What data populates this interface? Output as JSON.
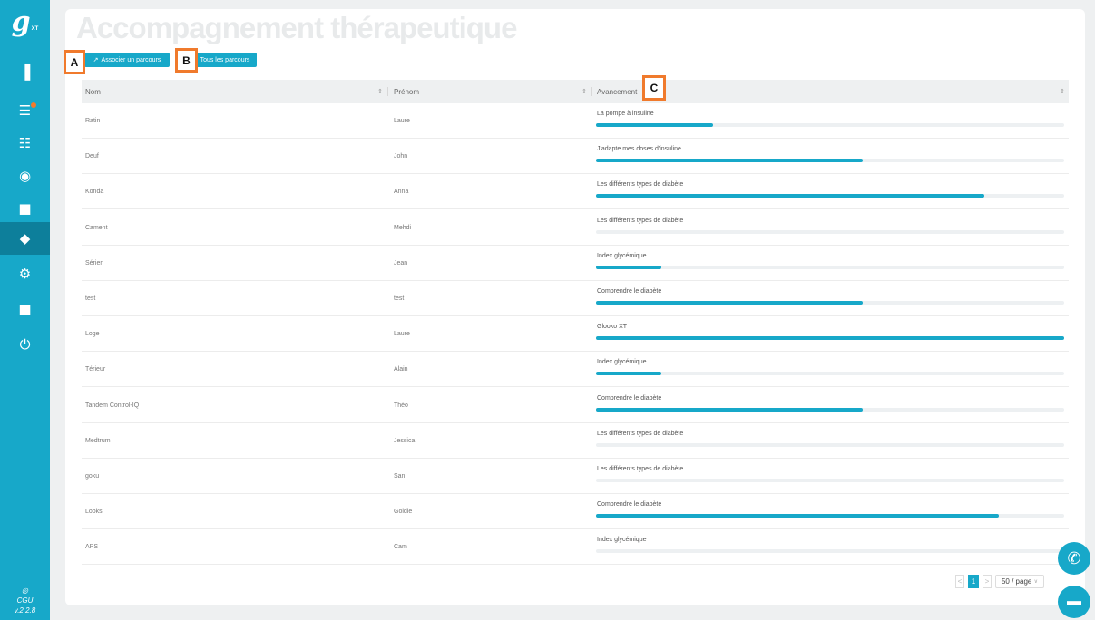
{
  "sidebar": {
    "logo_letter": "g",
    "logo_suffix": "XT",
    "items": [
      {
        "icon": "chart-bar-icon",
        "glyph": "▐"
      },
      {
        "icon": "list-icon",
        "glyph": "☰"
      },
      {
        "icon": "document-check-icon",
        "glyph": "☷"
      },
      {
        "icon": "users-icon",
        "glyph": "◉"
      },
      {
        "icon": "chat-icon",
        "glyph": "■"
      },
      {
        "icon": "graduation-cap-icon",
        "glyph": "◆"
      },
      {
        "icon": "gear-icon",
        "glyph": "⚙"
      },
      {
        "icon": "book-icon",
        "glyph": "■"
      },
      {
        "icon": "power-icon",
        "glyph": "⏻"
      }
    ],
    "globe_glyph": "◎",
    "cgu_label": "CGU",
    "version": "v.2.2.8"
  },
  "page": {
    "title": "Accompagnement thérapeutique"
  },
  "buttons": {
    "associer_label": "Associer un parcours",
    "associer_icon": "↗",
    "tous_label": "Tous les parcours"
  },
  "annotations": {
    "a": "A",
    "b": "B",
    "c": "C"
  },
  "table": {
    "headers": {
      "nom": "Nom",
      "prenom": "Prénom",
      "avancement": "Avancement"
    },
    "sort_glyph": "⇕",
    "rows": [
      {
        "nom": "Ratin",
        "prenom": "Laure",
        "parcours": "La pompe à insuline",
        "progress": 0.25
      },
      {
        "nom": "Deuf",
        "prenom": "John",
        "parcours": "J'adapte mes doses d'insuline",
        "progress": 0.57
      },
      {
        "nom": "Konda",
        "prenom": "Anna",
        "parcours": "Les différents types de diabète",
        "progress": 0.83
      },
      {
        "nom": "Cament",
        "prenom": "Mehdi",
        "parcours": "Les différents types de diabète",
        "progress": 0.0
      },
      {
        "nom": "Sérien",
        "prenom": "Jean",
        "parcours": "Index glycémique",
        "progress": 0.14
      },
      {
        "nom": "test",
        "prenom": "test",
        "parcours": "Comprendre le diabète",
        "progress": 0.57
      },
      {
        "nom": "Loge",
        "prenom": "Laure",
        "parcours": "Glooko XT",
        "progress": 1.0
      },
      {
        "nom": "Térieur",
        "prenom": "Alain",
        "parcours": "Index glycémique",
        "progress": 0.14
      },
      {
        "nom": "Tandem Control-IQ",
        "prenom": "Théo",
        "parcours": "Comprendre le diabète",
        "progress": 0.57
      },
      {
        "nom": "Medtrum",
        "prenom": "Jessica",
        "parcours": "Les différents types de diabète",
        "progress": 0.0
      },
      {
        "nom": "goku",
        "prenom": "San",
        "parcours": "Les différents types de diabète",
        "progress": 0.0
      },
      {
        "nom": "Looks",
        "prenom": "Goldie",
        "parcours": "Comprendre le diabète",
        "progress": 0.86
      },
      {
        "nom": "APS",
        "prenom": "Cam",
        "parcours": "Index glycémique",
        "progress": 0.0
      }
    ]
  },
  "pagination": {
    "prev_glyph": "<",
    "current_page": "1",
    "next_glyph": ">",
    "page_size": "50 / page",
    "dropdown_glyph": "∨"
  },
  "fabs": {
    "phone_glyph": "✆",
    "chat_glyph": "▬"
  },
  "colors": {
    "accent": "#17a8c9",
    "annotation_border": "#f07a2c",
    "notification_dot": "#f47a2c"
  }
}
